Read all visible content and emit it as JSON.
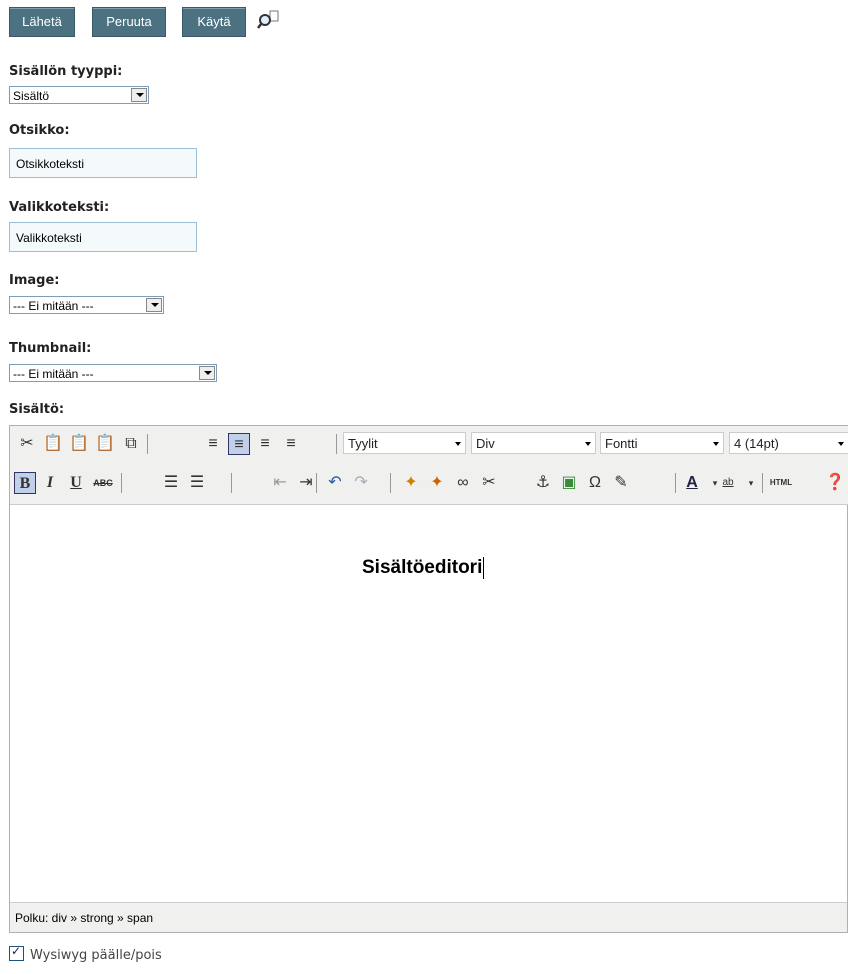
{
  "toolbar": {
    "send_label": "Lähetä",
    "cancel_label": "Peruuta",
    "apply_label": "Käytä"
  },
  "form": {
    "content_type": {
      "label": "Sisällön tyyppi:",
      "value": "Sisältö"
    },
    "title": {
      "label": "Otsikko:",
      "value": "Otsikkoteksti"
    },
    "menu_text": {
      "label": "Valikkoteksti:",
      "value": "Valikkoteksti"
    },
    "image": {
      "label": "Image:",
      "value": "--- Ei mitään ---"
    },
    "thumbnail": {
      "label": "Thumbnail:",
      "value": "--- Ei mitään ---"
    },
    "content": {
      "label": "Sisältö:"
    }
  },
  "editor": {
    "styles_dropdown": "Tyylit",
    "format_dropdown": "Div",
    "font_dropdown": "Fontti",
    "size_dropdown": "4 (14pt)",
    "html_button": "HTML",
    "content_text": "Sisältöeditori",
    "path": "Polku: div » strong » span"
  },
  "wysiwyg_toggle": {
    "label": "Wysiwyg päälle/pois",
    "checked": true
  }
}
